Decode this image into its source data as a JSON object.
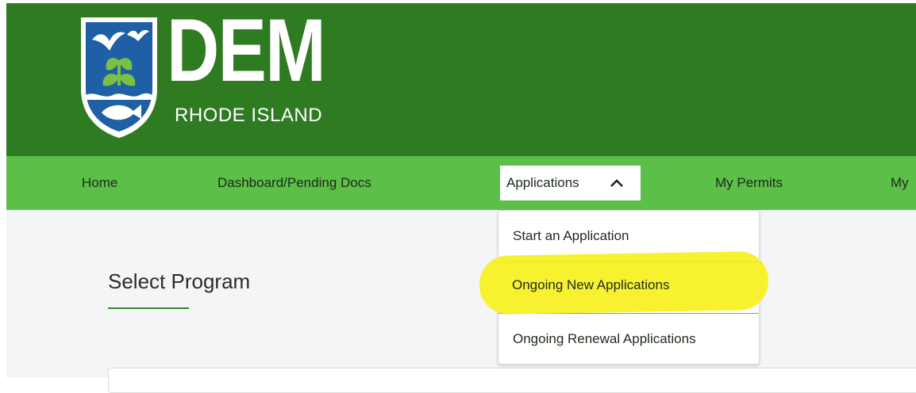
{
  "brand": {
    "logo_text": "DEM",
    "logo_subtext": "RHODE ISLAND",
    "header_color": "#2f7b22",
    "nav_color": "#5cbf47",
    "accent_underline": "#2f8a2a",
    "highlight_color": "#f7f01e"
  },
  "nav": {
    "items": [
      {
        "label": "Home"
      },
      {
        "label": "Dashboard/Pending Docs"
      },
      {
        "label": "Applications",
        "icon": "chevron-up-icon",
        "active": true
      },
      {
        "label": "My Permits"
      },
      {
        "label": "My"
      }
    ]
  },
  "dropdown": {
    "items": [
      {
        "label": "Start an Application"
      },
      {
        "label": "Ongoing New Applications",
        "highlighted": true
      },
      {
        "label": "Ongoing Renewal Applications"
      }
    ]
  },
  "main": {
    "title": "Select Program"
  }
}
